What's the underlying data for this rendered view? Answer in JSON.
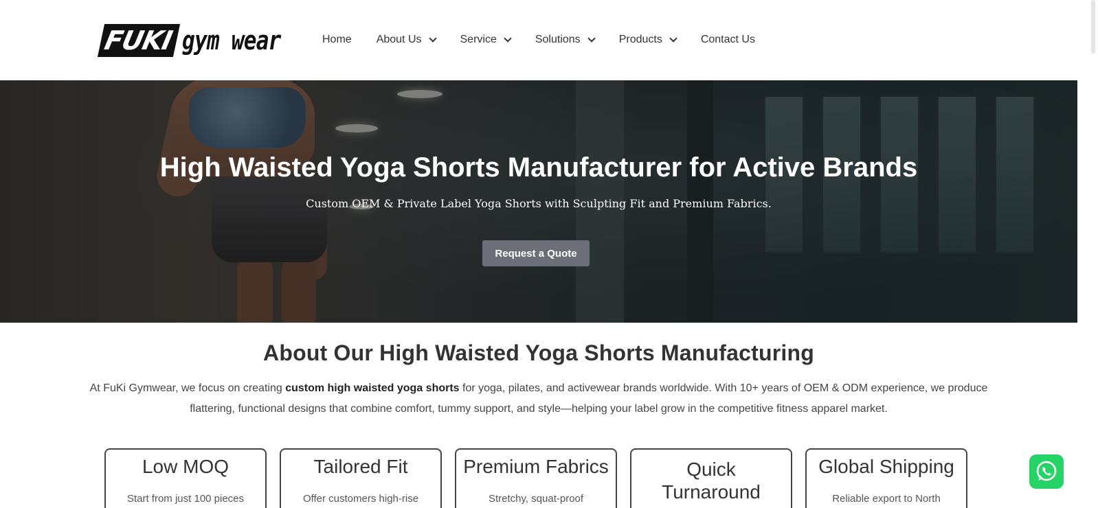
{
  "header": {
    "logo_brand": "FUKI",
    "logo_tagline": "gym wear",
    "nav": [
      {
        "label": "Home",
        "has_dropdown": false
      },
      {
        "label": "About Us",
        "has_dropdown": true
      },
      {
        "label": "Service",
        "has_dropdown": true
      },
      {
        "label": "Solutions",
        "has_dropdown": true
      },
      {
        "label": "Products",
        "has_dropdown": true
      },
      {
        "label": "Contact Us",
        "has_dropdown": false
      }
    ]
  },
  "hero": {
    "title": "High Waisted Yoga Shorts Manufacturer for Active Brands",
    "subtitle": "Custom OEM & Private Label Yoga Shorts with Sculpting Fit and Premium Fabrics.",
    "cta_label": "Request a Quote"
  },
  "about": {
    "title": "About Our High Waisted Yoga Shorts Manufacturing",
    "text_before": "At FuKi Gymwear, we focus on creating ",
    "text_bold": "custom high waisted yoga shorts",
    "text_after": " for yoga, pilates, and activewear brands worldwide. With 10+ years of OEM & ODM experience, we produce flattering, functional designs that combine comfort, tummy support, and style—helping your label grow in the competitive fitness apparel market."
  },
  "cards": [
    {
      "title": "Low MOQ",
      "desc": "Start from just 100 pieces"
    },
    {
      "title": "Tailored Fit",
      "desc": "Offer customers high-rise"
    },
    {
      "title": "Premium Fabrics",
      "desc": "Stretchy, squat-proof"
    },
    {
      "title": "Quick Turnaround",
      "desc": ""
    },
    {
      "title": "Global Shipping",
      "desc": "Reliable export to North"
    }
  ],
  "colors": {
    "cta_bg": "#6c6f78",
    "whatsapp": "#25d366",
    "text": "#333333"
  },
  "icons": {
    "nav_dropdown": "chevron-down-icon",
    "floating_chat": "whatsapp-icon"
  }
}
